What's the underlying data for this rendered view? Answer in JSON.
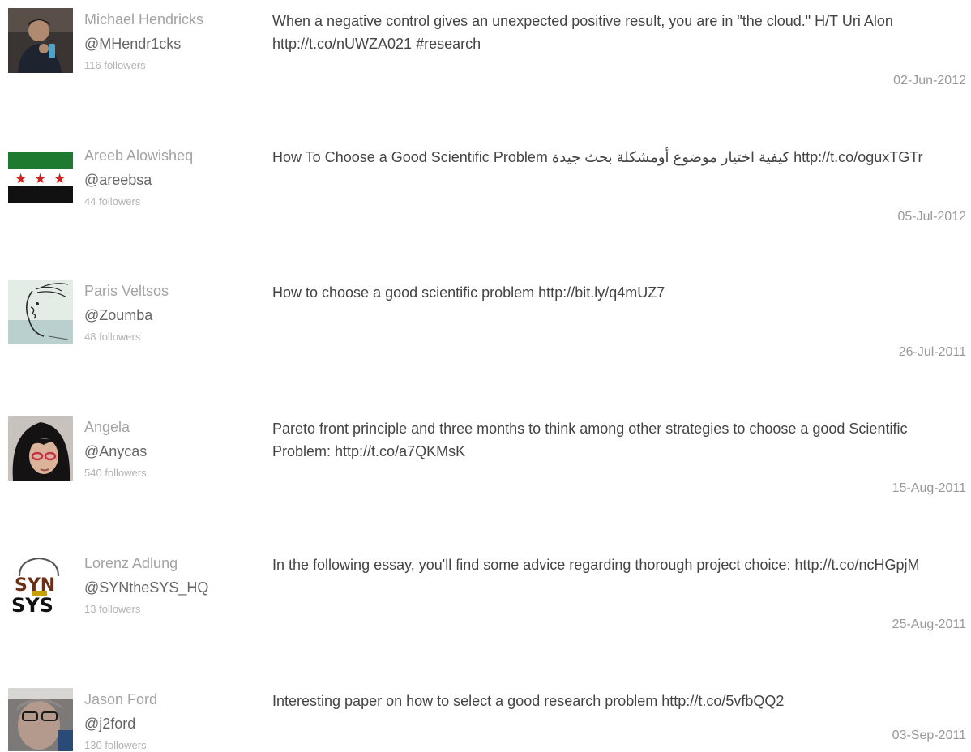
{
  "tweets": [
    {
      "name": "Michael Hendricks",
      "handle": "@MHendr1cks",
      "followers": "116 followers",
      "text": "When a negative control gives an unexpected positive result, you are in \"the cloud.\" H/T Uri Alon http://t.co/nUWZA021 #research",
      "date": "02-Jun-2012"
    },
    {
      "name": "Areeb Alowisheq",
      "handle": "@areebsa",
      "followers": "44 followers",
      "text": "How To Choose a Good Scientific Problem كيفية اختيار موضوع أومشكلة بحث جيدة http://t.co/oguxTGTr",
      "date": "05-Jul-2012"
    },
    {
      "name": "Paris Veltsos",
      "handle": "@Zoumba",
      "followers": "48 followers",
      "text": "How to choose a good scientific problem http://bit.ly/q4mUZ7",
      "date": "26-Jul-2011"
    },
    {
      "name": "Angela",
      "handle": "@Anycas",
      "followers": "540 followers",
      "text": "Pareto front principle and three months to think among other strategies to choose a good Scientific Problem: http://t.co/a7QKMsK",
      "date": "15-Aug-2011"
    },
    {
      "name": "Lorenz Adlung",
      "handle": "@SYNtheSYS_HQ",
      "followers": "13 followers",
      "text": "In the following essay, you'll find some advice regarding thorough project choice: http://t.co/ncHGpjM",
      "date": "25-Aug-2011"
    },
    {
      "name": "Jason Ford",
      "handle": "@j2ford",
      "followers": "130 followers",
      "text": "Interesting paper on how to select a good research problem http://t.co/5vfbQQ2",
      "date": "03-Sep-2011"
    }
  ],
  "avatars": [
    "person-photo-avatar",
    "flag-avatar",
    "sketch-face-avatar",
    "woman-glasses-avatar",
    "syn-logo-avatar",
    "man-photo-avatar"
  ],
  "colors": {
    "name": "#a3a3a3",
    "handle": "#666666",
    "followers": "#b3b3b3",
    "text": "#444444",
    "date": "#999999",
    "flag_green": "#1e7a2e",
    "flag_star_red": "#d02020"
  }
}
